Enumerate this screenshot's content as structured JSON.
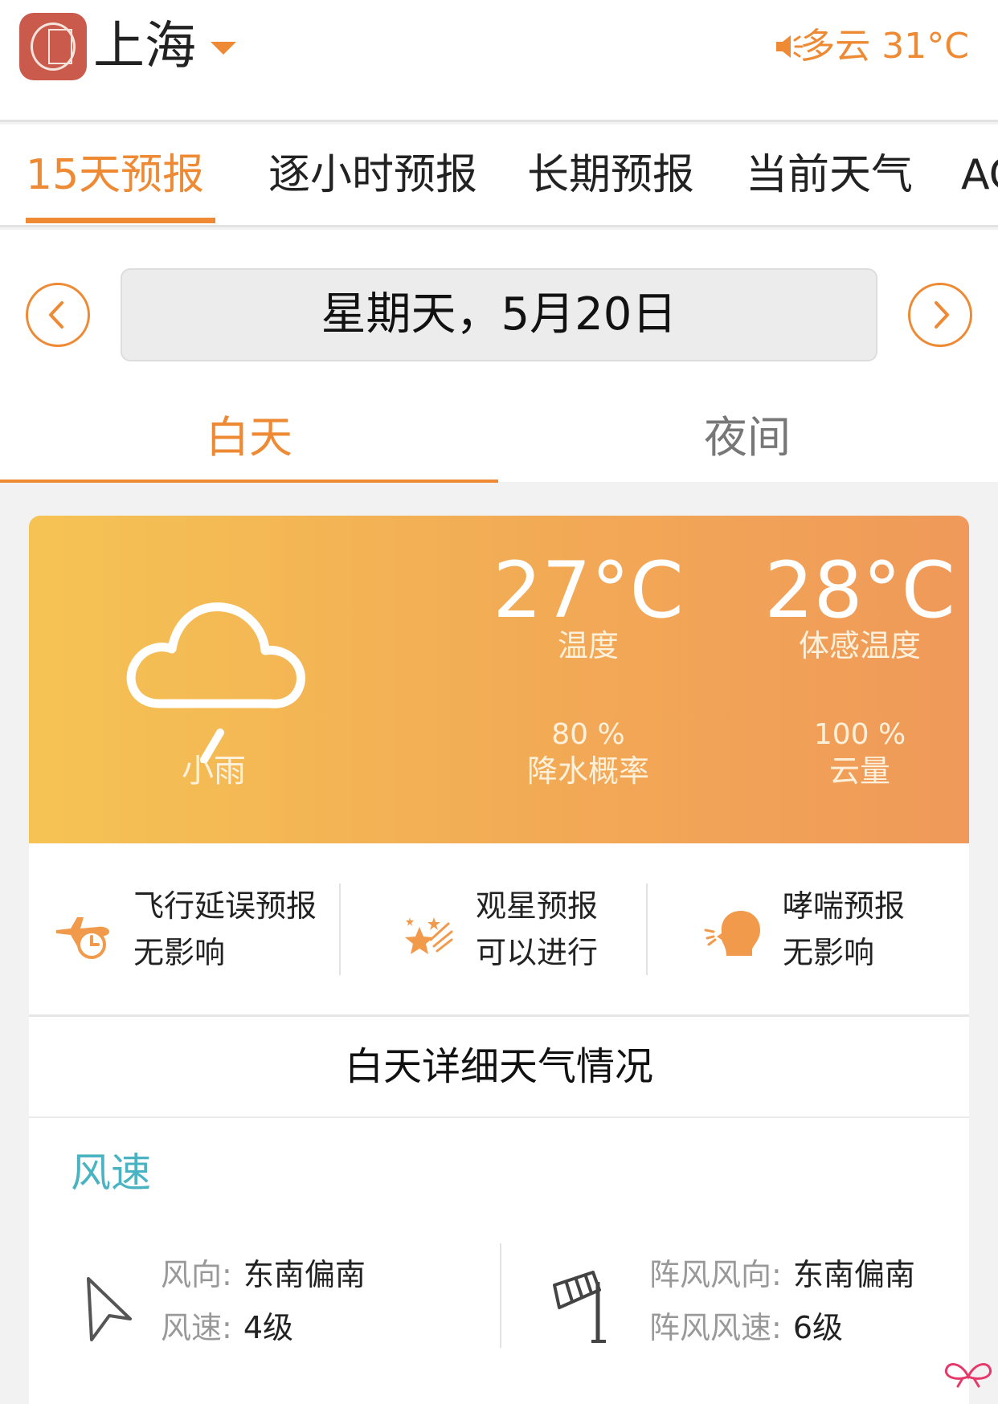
{
  "header": {
    "city": "上海",
    "current_weather": "多云 31°C"
  },
  "tabs": [
    {
      "label": "15天预报",
      "active": true
    },
    {
      "label": "逐小时预报"
    },
    {
      "label": "长期预报"
    },
    {
      "label": "当前天气"
    },
    {
      "label": "AQ"
    }
  ],
  "date": {
    "label": "星期天，5月20日"
  },
  "day_night": {
    "day": "白天",
    "night": "夜间",
    "selected": "day"
  },
  "card": {
    "condition": "小雨",
    "temp": "27°C",
    "temp_label": "温度",
    "feels": "28°C",
    "feels_label": "体感温度",
    "precip": "80 %",
    "precip_label": "降水概率",
    "cloud": "100 %",
    "cloud_label": "云量"
  },
  "indices": [
    {
      "title": "飞行延误预报",
      "value": "无影响",
      "icon": "airplane-clock-icon"
    },
    {
      "title": "观星预报",
      "value": "可以进行",
      "icon": "shooting-star-icon"
    },
    {
      "title": "哮喘预报",
      "value": "无影响",
      "icon": "face-breath-icon"
    }
  ],
  "detail": {
    "title": "白天详细天气情况",
    "section": "风速",
    "wind_dir_label": "风向:",
    "wind_dir": "东南偏南",
    "wind_speed_label": "风速:",
    "wind_speed": "4级",
    "gust_dir_label": "阵风风向:",
    "gust_dir": "东南偏南",
    "gust_speed_label": "阵风风速:",
    "gust_speed": "6级"
  },
  "colors": {
    "accent": "#ee8a34",
    "section": "#49b3c2"
  }
}
